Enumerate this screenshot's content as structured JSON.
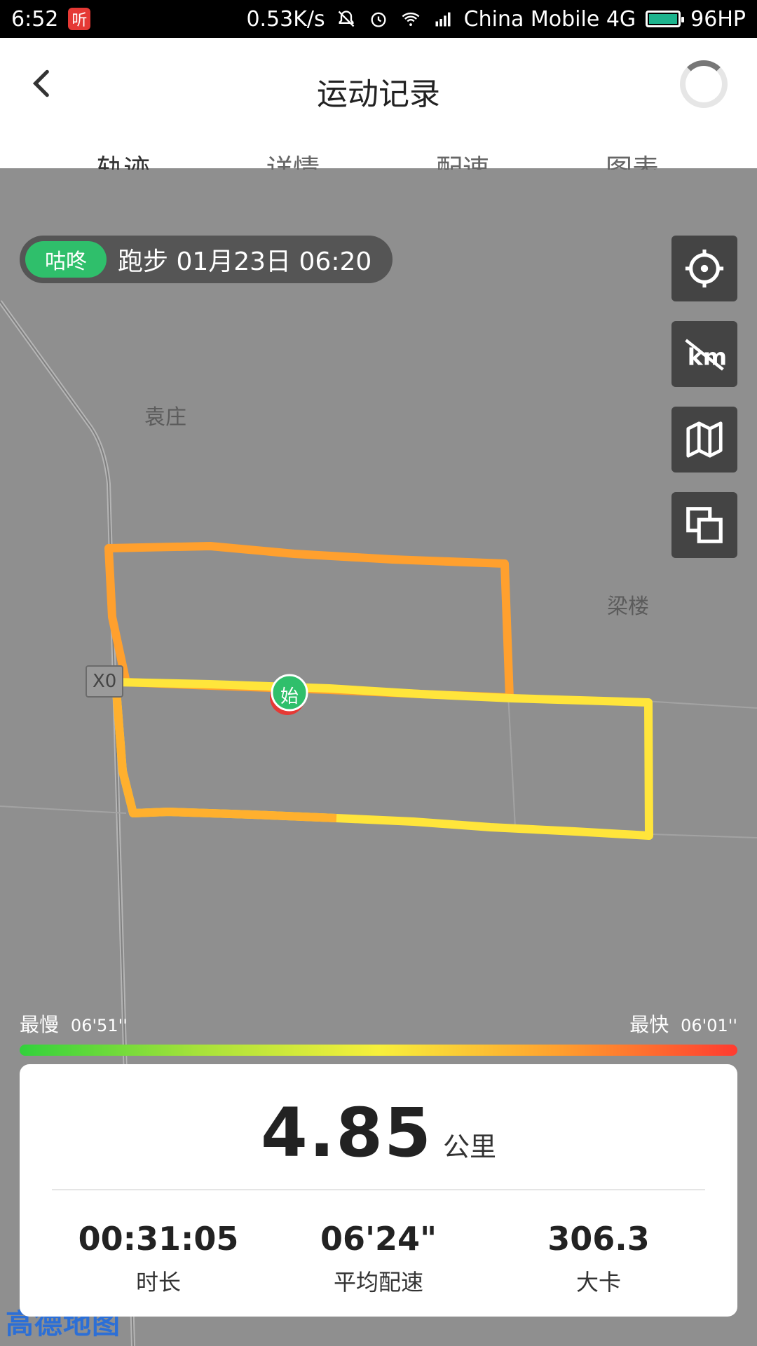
{
  "status_bar": {
    "time": "6:52",
    "app_badge": "听",
    "speed": "0.53K/s",
    "carrier": "China Mobile 4G",
    "battery": "96HP"
  },
  "header": {
    "title": "运动记录",
    "tabs": [
      "轨迹",
      "详情",
      "配速",
      "图表"
    ],
    "active_tab_index": 0
  },
  "activity": {
    "brand": "咕咚",
    "type_time": "跑步  01月23日 06:20"
  },
  "map": {
    "labels": [
      "袁庄",
      "梁楼"
    ],
    "road_tag": "X0",
    "start_marker": "始",
    "logo_text": "高德地图"
  },
  "legend": {
    "slow_label": "最慢",
    "slow_pace": "06'51''",
    "fast_label": "最快",
    "fast_pace": "06'01''"
  },
  "summary": {
    "distance": "4.85",
    "distance_unit": "公里",
    "duration_value": "00:31:05",
    "duration_label": "时长",
    "avg_pace_value": "06'24\"",
    "avg_pace_label": "平均配速",
    "calories_value": "306.3",
    "calories_label": "大卡"
  },
  "colors": {
    "accent_green": "#2fbf6b",
    "route_orange": "#ffa02e",
    "route_yellow": "#ffe53b",
    "map_gray": "#8f8f8f"
  }
}
